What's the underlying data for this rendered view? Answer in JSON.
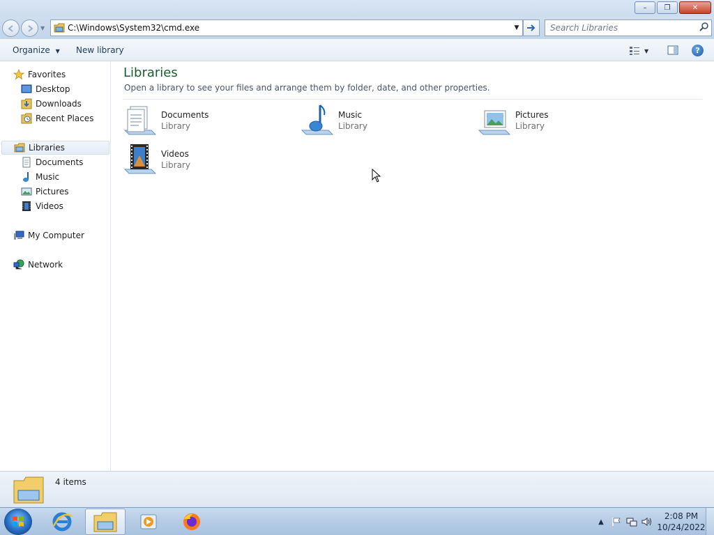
{
  "window": {
    "controls": {
      "minimize": "–",
      "maximize": "❐",
      "close": "✕"
    }
  },
  "navigation": {
    "address": "C:\\Windows\\System32\\cmd.exe",
    "search_placeholder": "Search Libraries"
  },
  "toolbar": {
    "organize_label": "Organize",
    "new_library_label": "New library",
    "help_label": "?"
  },
  "sidebar": {
    "favorites": {
      "label": "Favorites",
      "items": [
        {
          "label": "Desktop",
          "icon": "desktop-icon"
        },
        {
          "label": "Downloads",
          "icon": "downloads-icon"
        },
        {
          "label": "Recent Places",
          "icon": "recent-places-icon"
        }
      ]
    },
    "libraries": {
      "label": "Libraries",
      "items": [
        {
          "label": "Documents",
          "icon": "documents-icon"
        },
        {
          "label": "Music",
          "icon": "music-icon"
        },
        {
          "label": "Pictures",
          "icon": "pictures-icon"
        },
        {
          "label": "Videos",
          "icon": "videos-icon"
        }
      ]
    },
    "computer": {
      "label": "My Computer"
    },
    "network": {
      "label": "Network"
    }
  },
  "main": {
    "title": "Libraries",
    "subtitle": "Open a library to see your files and arrange them by folder, date, and other properties.",
    "libraries": [
      {
        "name": "Documents",
        "type": "Library",
        "icon": "documents-library-icon"
      },
      {
        "name": "Music",
        "type": "Library",
        "icon": "music-library-icon"
      },
      {
        "name": "Pictures",
        "type": "Library",
        "icon": "pictures-library-icon"
      },
      {
        "name": "Videos",
        "type": "Library",
        "icon": "videos-library-icon"
      }
    ]
  },
  "status": {
    "item_count": "4 items"
  },
  "taskbar": {
    "apps": [
      "internet-explorer-icon",
      "windows-explorer-icon",
      "media-player-icon",
      "firefox-icon"
    ],
    "clock_time": "2:08 PM",
    "clock_date": "10/24/2022"
  },
  "colors": {
    "title_green": "#1e5a2f",
    "accent_blue": "#1c5aa7"
  }
}
